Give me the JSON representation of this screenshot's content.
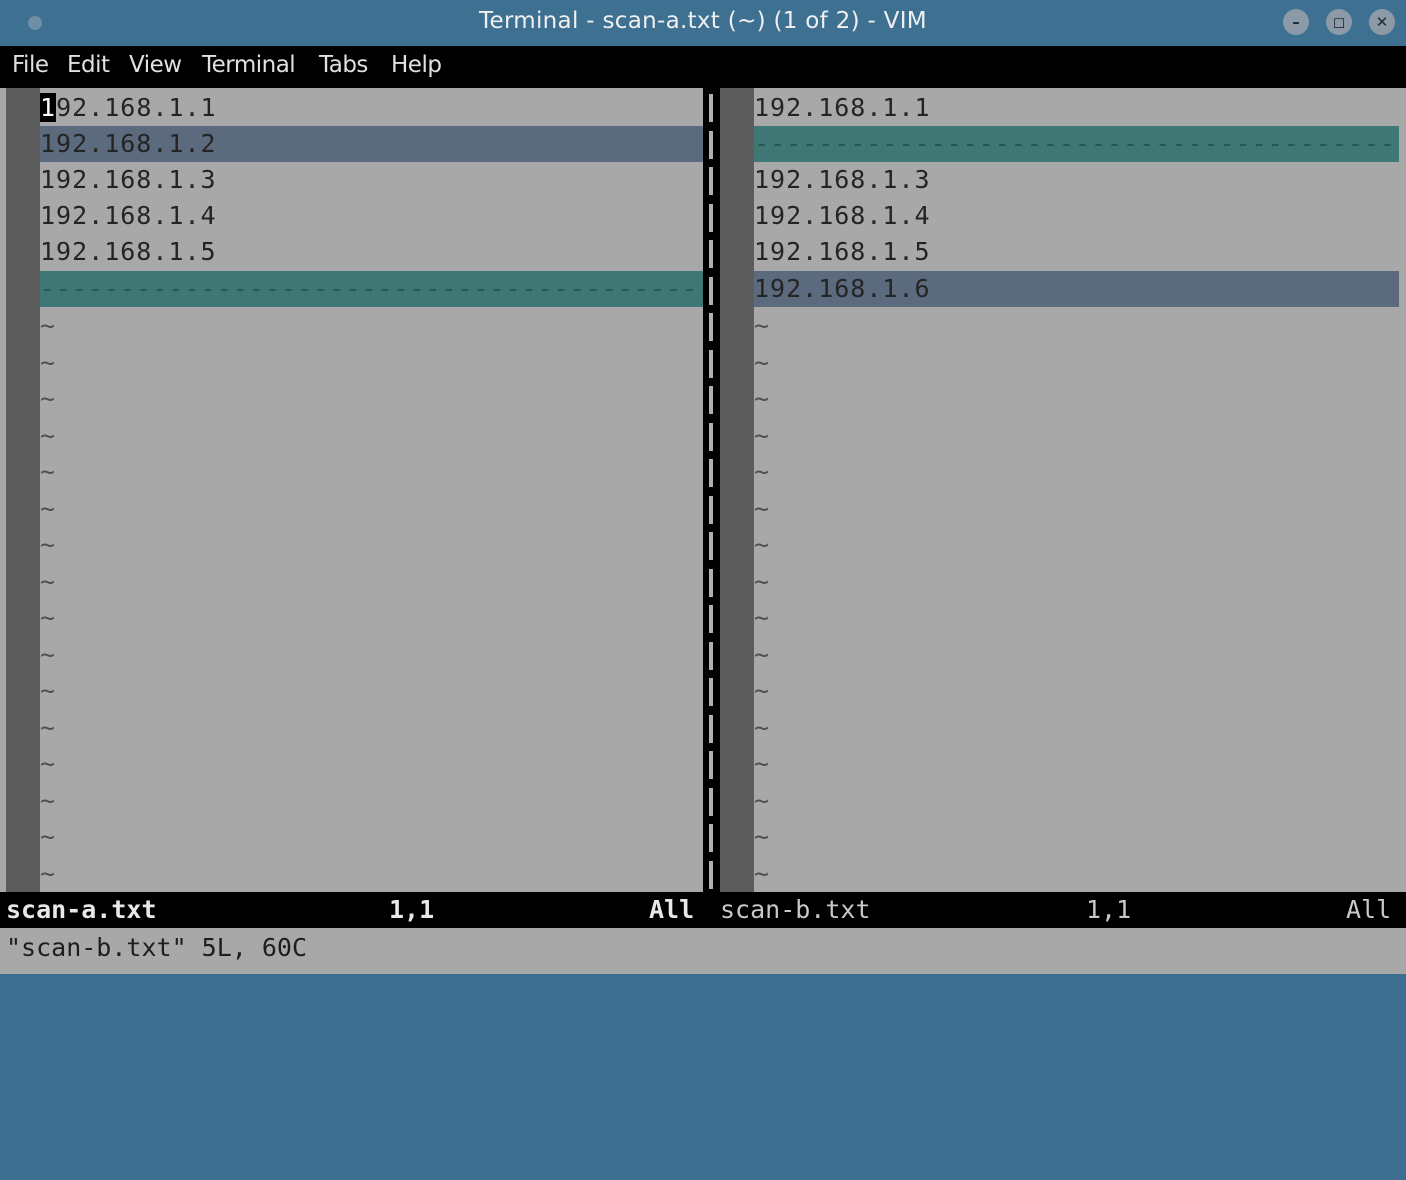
{
  "window": {
    "title": "Terminal - scan-a.txt (~) (1 of 2) - VIM",
    "minimize_icon": "minimize-icon",
    "maximize_icon": "maximize-icon",
    "close_icon": "close-icon"
  },
  "menu": {
    "items": [
      "File",
      "Edit",
      "View",
      "Terminal",
      "Tabs",
      "Help"
    ]
  },
  "left_pane": {
    "lines": [
      {
        "type": "normal",
        "text": "192.168.1.1",
        "cursor_char": "1",
        "rest": "92.168.1.1"
      },
      {
        "type": "change",
        "text": "192.168.1.2"
      },
      {
        "type": "normal",
        "text": "192.168.1.3"
      },
      {
        "type": "normal",
        "text": "192.168.1.4"
      },
      {
        "type": "normal",
        "text": "192.168.1.5"
      },
      {
        "type": "filler",
        "text": "------------------------------------------------"
      }
    ]
  },
  "right_pane": {
    "lines": [
      {
        "type": "normal",
        "text": "192.168.1.1"
      },
      {
        "type": "filler",
        "text": "----------------------------------------------------------------"
      },
      {
        "type": "normal",
        "text": "192.168.1.3"
      },
      {
        "type": "normal",
        "text": "192.168.1.4"
      },
      {
        "type": "normal",
        "text": "192.168.1.5"
      },
      {
        "type": "change",
        "text": "192.168.1.6"
      }
    ]
  },
  "empty_line_marker": "~",
  "status": {
    "left_file": "scan-a.txt",
    "left_pos": "1,1",
    "left_scroll": "All",
    "right_file": "scan-b.txt",
    "right_pos": "1,1",
    "right_scroll": "All"
  },
  "command_line": "\"scan-b.txt\" 5L, 60C",
  "colors": {
    "titlebar": "#3d7091",
    "editor_bg": "#a8a8a8",
    "diff_change": "#5c6a7d",
    "diff_filler": "#3e7773"
  }
}
